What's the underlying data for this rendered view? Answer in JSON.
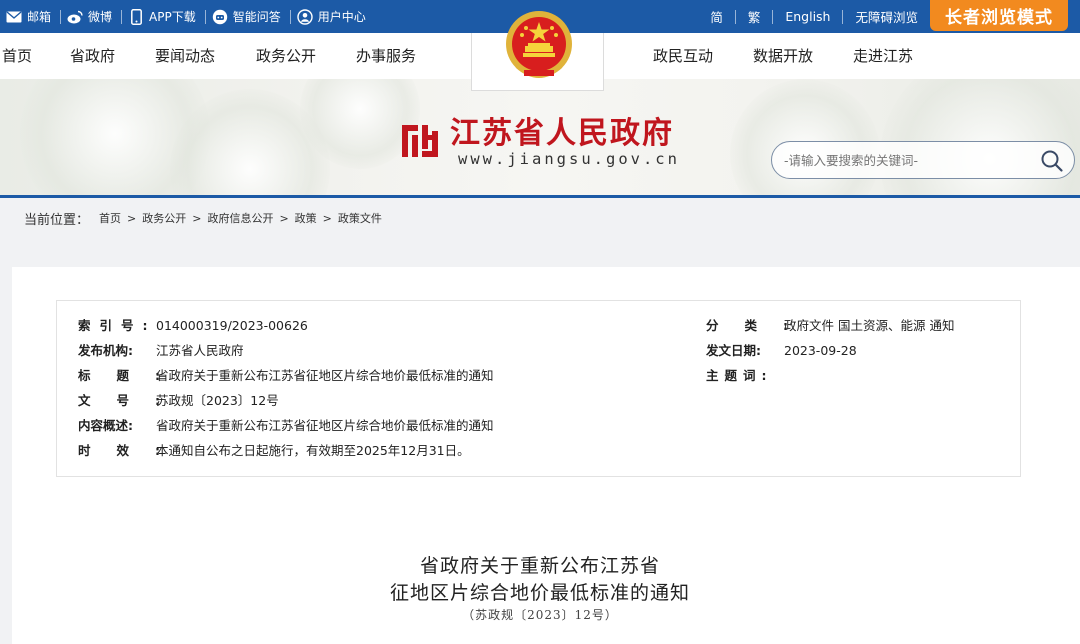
{
  "topbar": {
    "left_items": [
      {
        "label": "邮箱",
        "icon": "mail-icon"
      },
      {
        "label": "微博",
        "icon": "weibo-icon"
      },
      {
        "label": "APP下载",
        "icon": "phone-icon"
      },
      {
        "label": "智能问答",
        "icon": "robot-icon"
      },
      {
        "label": "用户中心",
        "icon": "user-icon"
      }
    ],
    "right_links": [
      "简",
      "繁",
      "English",
      "无障碍浏览"
    ],
    "elder_mode": "长者浏览模式"
  },
  "nav": {
    "left": [
      "首页",
      "省政府",
      "要闻动态",
      "政务公开",
      "办事服务"
    ],
    "right": [
      "政民互动",
      "数据开放",
      "走进江苏"
    ]
  },
  "header": {
    "site_name": "江苏省人民政府",
    "site_url": "www.jiangsu.gov.cn",
    "search_placeholder": "-请输入要搜索的关键词-"
  },
  "breadcrumb": {
    "label": "当前位置：",
    "items": [
      "首页",
      "政务公开",
      "政府信息公开",
      "政策",
      "政策文件"
    ]
  },
  "meta": {
    "index_no_k": "索引号:",
    "index_no": "014000319/2023-00626",
    "publisher_k": "发布机构:",
    "publisher": "江苏省人民政府",
    "title_k": "标题:",
    "title": "省政府关于重新公布江苏省征地区片综合地价最低标准的通知",
    "doc_no_k": "文号:",
    "doc_no": "苏政规〔2023〕12号",
    "summary_k": "内容概述:",
    "summary": "省政府关于重新公布江苏省征地区片综合地价最低标准的通知",
    "validity_k": "时效:",
    "validity": "本通知自公布之日起施行，有效期至2025年12月31日。",
    "category_k": "分类:",
    "category": "政府文件 国土资源、能源 通知",
    "date_k": "发文日期:",
    "date": "2023-09-28",
    "subject_k": "主题词:",
    "subject": ""
  },
  "document": {
    "title_line1": "省政府关于重新公布江苏省",
    "title_line2": "征地区片综合地价最低标准的通知",
    "number": "（苏政规〔2023〕12号）"
  },
  "colors": {
    "primary": "#1c5aa6",
    "accent": "#f28a1f",
    "brand_red": "#c0161e"
  }
}
